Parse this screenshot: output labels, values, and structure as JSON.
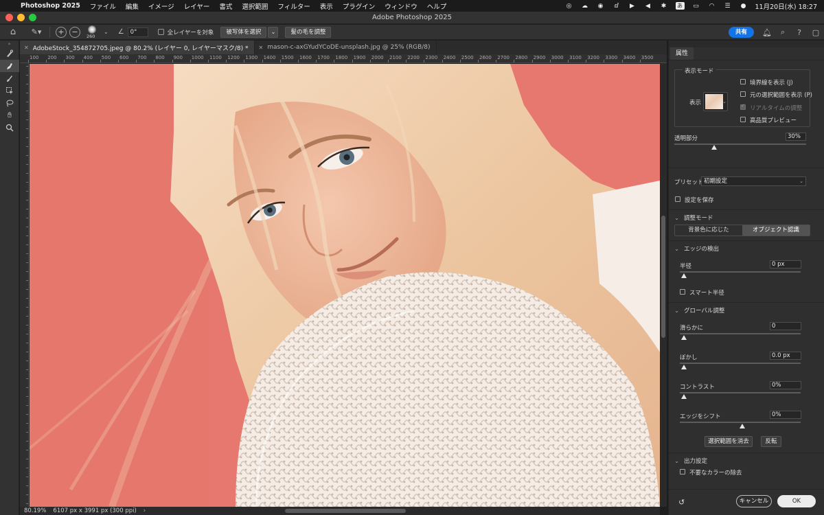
{
  "menubar": {
    "app_name": "Photoshop 2025",
    "items": [
      "ファイル",
      "編集",
      "イメージ",
      "レイヤー",
      "書式",
      "選択範囲",
      "フィルター",
      "表示",
      "プラグイン",
      "ウィンドウ",
      "ヘルプ"
    ],
    "ime": "あ",
    "clock": "11月20日(水)  18:27"
  },
  "window": {
    "title": "Adobe Photoshop 2025"
  },
  "options_bar": {
    "brush_size": "260",
    "angle": "0°",
    "all_layers_label": "全レイヤーを対象",
    "select_subject_label": "被写体を選択",
    "refine_hair_label": "髪の毛を調整",
    "share_label": "共有"
  },
  "tabs": [
    {
      "label": "AdobeStock_354872705.jpeg @ 80.2% (レイヤー 0, レイヤーマスク/8) *"
    },
    {
      "label": "mason-c-axGYudYCoDE-unsplash.jpg @ 25% (RGB/8)"
    }
  ],
  "ruler": {
    "top_labels": [
      "100",
      "200",
      "300",
      "400",
      "500",
      "600",
      "700",
      "800",
      "900",
      "1000",
      "1100",
      "1200",
      "1300",
      "1400",
      "1500",
      "1600",
      "1700",
      "1800",
      "1900",
      "2000",
      "2100",
      "2200",
      "2300",
      "2400",
      "2500",
      "2600",
      "2700",
      "2800",
      "2900",
      "3000",
      "3100",
      "3200",
      "3300",
      "3400",
      "3500"
    ]
  },
  "status": {
    "zoom": "80.19%",
    "doc_info": "6107 px x 3991 px (300 ppi)"
  },
  "panel": {
    "tab_label": "属性",
    "view_mode": {
      "header": "表示モード",
      "view_label": "表示",
      "show_edges": "境界線を表示 (J)",
      "show_original": "元の選択範囲を表示 (P)",
      "realtime": "リアルタイムの調整",
      "hq_preview": "高品質プレビュー"
    },
    "transparency": {
      "label": "透明部分",
      "value": "30%",
      "level_percent": 30
    },
    "preset": {
      "label": "プリセット",
      "value": "初期設定"
    },
    "save_settings": "設定を保存",
    "adjust_mode": {
      "header": "調整モード",
      "options": [
        "背景色に応じた",
        "オブジェクト認識"
      ],
      "selected_index": 1
    },
    "edge_detection": {
      "header": "エッジの検出",
      "radius_label": "半径",
      "radius_value": "0 px",
      "smart_radius": "スマート半径"
    },
    "global": {
      "header": "グローバル調整",
      "smooth_label": "滑らかに",
      "smooth_value": "0",
      "feather_label": "ぼかし",
      "feather_value": "0.0 px",
      "contrast_label": "コントラスト",
      "contrast_value": "0%",
      "shift_label": "エッジをシフト",
      "shift_value": "0%",
      "clear_selection": "選択範囲を消去",
      "invert": "反転"
    },
    "output": {
      "header": "出力設定",
      "decontaminate": "不要なカラーの除去"
    },
    "cancel": "キャンセル",
    "ok": "OK"
  },
  "colors": {
    "accent": "#1473e6",
    "overlay": "#e7786f",
    "canvas_bg": "#1e1e1e"
  }
}
